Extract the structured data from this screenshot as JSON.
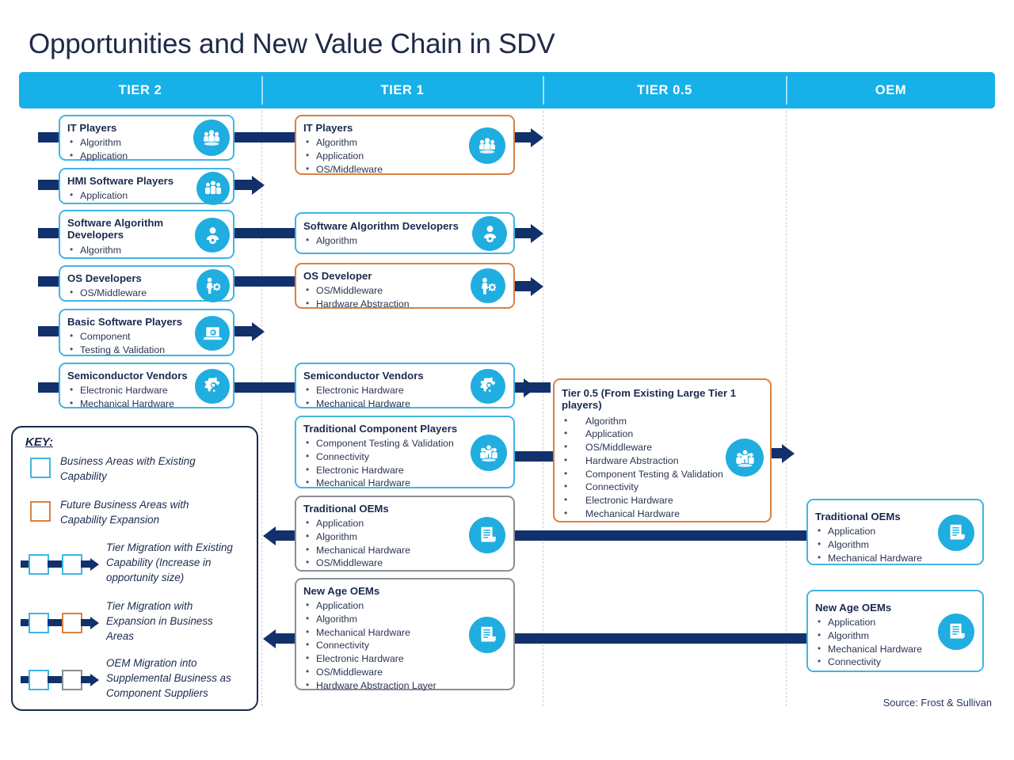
{
  "title": "Opportunities and New Value Chain in SDV",
  "source": "Source: Frost & Sullivan",
  "header": {
    "columns": [
      {
        "label": "TIER 2"
      },
      {
        "label": "TIER 1"
      },
      {
        "label": "TIER 0.5"
      },
      {
        "label": "OEM"
      }
    ]
  },
  "colors": {
    "header_band": "#17b0e8",
    "existing_capability_border": "#3fb6e3",
    "future_capability_border": "#d98141",
    "oem_border": "#8a8f96",
    "connector": "#12306b",
    "icon_circle": "#20ade0",
    "text": "#1b2a4e"
  },
  "tier2": {
    "nodes": [
      {
        "title": "IT Players",
        "items": [
          "Algorithm",
          "Application"
        ],
        "border": "blue",
        "icon": "people-group-icon"
      },
      {
        "title": "HMI Software Players",
        "items": [
          "Application"
        ],
        "border": "blue",
        "icon": "people-three-icon"
      },
      {
        "title": "Software Algorithm\nDevelopers",
        "title_line1": "Software Algorithm",
        "title_line2": "Developers",
        "items": [
          "Algorithm"
        ],
        "border": "blue",
        "icon": "person-gear-icon"
      },
      {
        "title": "OS Developers",
        "items": [
          "OS/Middleware"
        ],
        "border": "blue",
        "icon": "worker-gear-icon"
      },
      {
        "title": "Basic Software Players",
        "items": [
          "Component",
          "Testing & Validation"
        ],
        "border": "blue",
        "icon": "laptop-gear-icon"
      },
      {
        "title": "Semiconductor Vendors",
        "items": [
          "Electronic Hardware",
          "Mechanical Hardware"
        ],
        "border": "blue",
        "icon": "gear-wrench-icon"
      }
    ]
  },
  "tier1": {
    "nodes": [
      {
        "title": "IT Players",
        "items": [
          "Algorithm",
          "Application",
          "OS/Middleware"
        ],
        "border": "orange",
        "icon": "people-group-icon"
      },
      {
        "title": "Software Algorithm Developers",
        "items": [
          "Algorithm"
        ],
        "border": "blue",
        "icon": "person-gear-icon"
      },
      {
        "title": "OS Developer",
        "items": [
          "OS/Middleware",
          "Hardware Abstraction"
        ],
        "border": "orange",
        "icon": "worker-gear-icon"
      },
      {
        "title": "Semiconductor Vendors",
        "items": [
          "Electronic Hardware",
          "Mechanical Hardware"
        ],
        "border": "blue",
        "icon": "gear-wrench-icon"
      },
      {
        "title": "Traditional Component Players",
        "items": [
          "Component Testing & Validation",
          "Connectivity",
          "Electronic Hardware",
          "Mechanical Hardware"
        ],
        "border": "blue",
        "icon": "people-lift-icon"
      },
      {
        "title": "Traditional OEMs",
        "items": [
          "Application",
          "Algorithm",
          "Mechanical Hardware",
          "OS/Middleware"
        ],
        "border": "gray",
        "icon": "document-icon"
      },
      {
        "title": "New  Age OEMs",
        "items": [
          "Application",
          "Algorithm",
          "Mechanical Hardware",
          "Connectivity",
          "Electronic Hardware",
          "OS/Middleware",
          "Hardware Abstraction Layer"
        ],
        "border": "gray",
        "icon": "document-icon"
      }
    ]
  },
  "tier05": {
    "nodes": [
      {
        "title_line1": "Tier 0.5 (From Existing Large Tier 1",
        "title_line2": "players)",
        "items": [
          "Algorithm",
          "Application",
          "OS/Middleware",
          "Hardware Abstraction",
          "Component Testing & Validation",
          "Connectivity",
          "Electronic Hardware",
          "Mechanical Hardware"
        ],
        "border": "orange",
        "icon": "people-lift-icon"
      }
    ]
  },
  "oem": {
    "nodes": [
      {
        "title": "Traditional OEMs",
        "items": [
          "Application",
          "Algorithm",
          "Mechanical Hardware"
        ],
        "border": "blue",
        "icon": "document-icon"
      },
      {
        "title": "New Age OEMs",
        "items": [
          "Application",
          "Algorithm",
          "Mechanical Hardware",
          "Connectivity"
        ],
        "border": "blue",
        "icon": "document-icon"
      }
    ]
  },
  "key": {
    "title": "KEY:",
    "entries": [
      {
        "swatch": "blue",
        "line1": "Business Areas with Existing",
        "line2": "Capability",
        "line3": ""
      },
      {
        "swatch": "orange",
        "line1": "Future Business Areas with",
        "line2": "Capability Expansion",
        "line3": ""
      },
      {
        "swatch": "blue-blue-arrow",
        "line1": "Tier Migration with Existing",
        "line2": "Capability (Increase in",
        "line3": "opportunity size)"
      },
      {
        "swatch": "blue-orange-arrow",
        "line1": "Tier Migration with",
        "line2": "Expansion in Business",
        "line3": "Areas"
      },
      {
        "swatch": "blue-gray-arrow",
        "line1": "OEM Migration into",
        "line2": "Supplemental Business as",
        "line3": "Component Suppliers"
      }
    ]
  }
}
